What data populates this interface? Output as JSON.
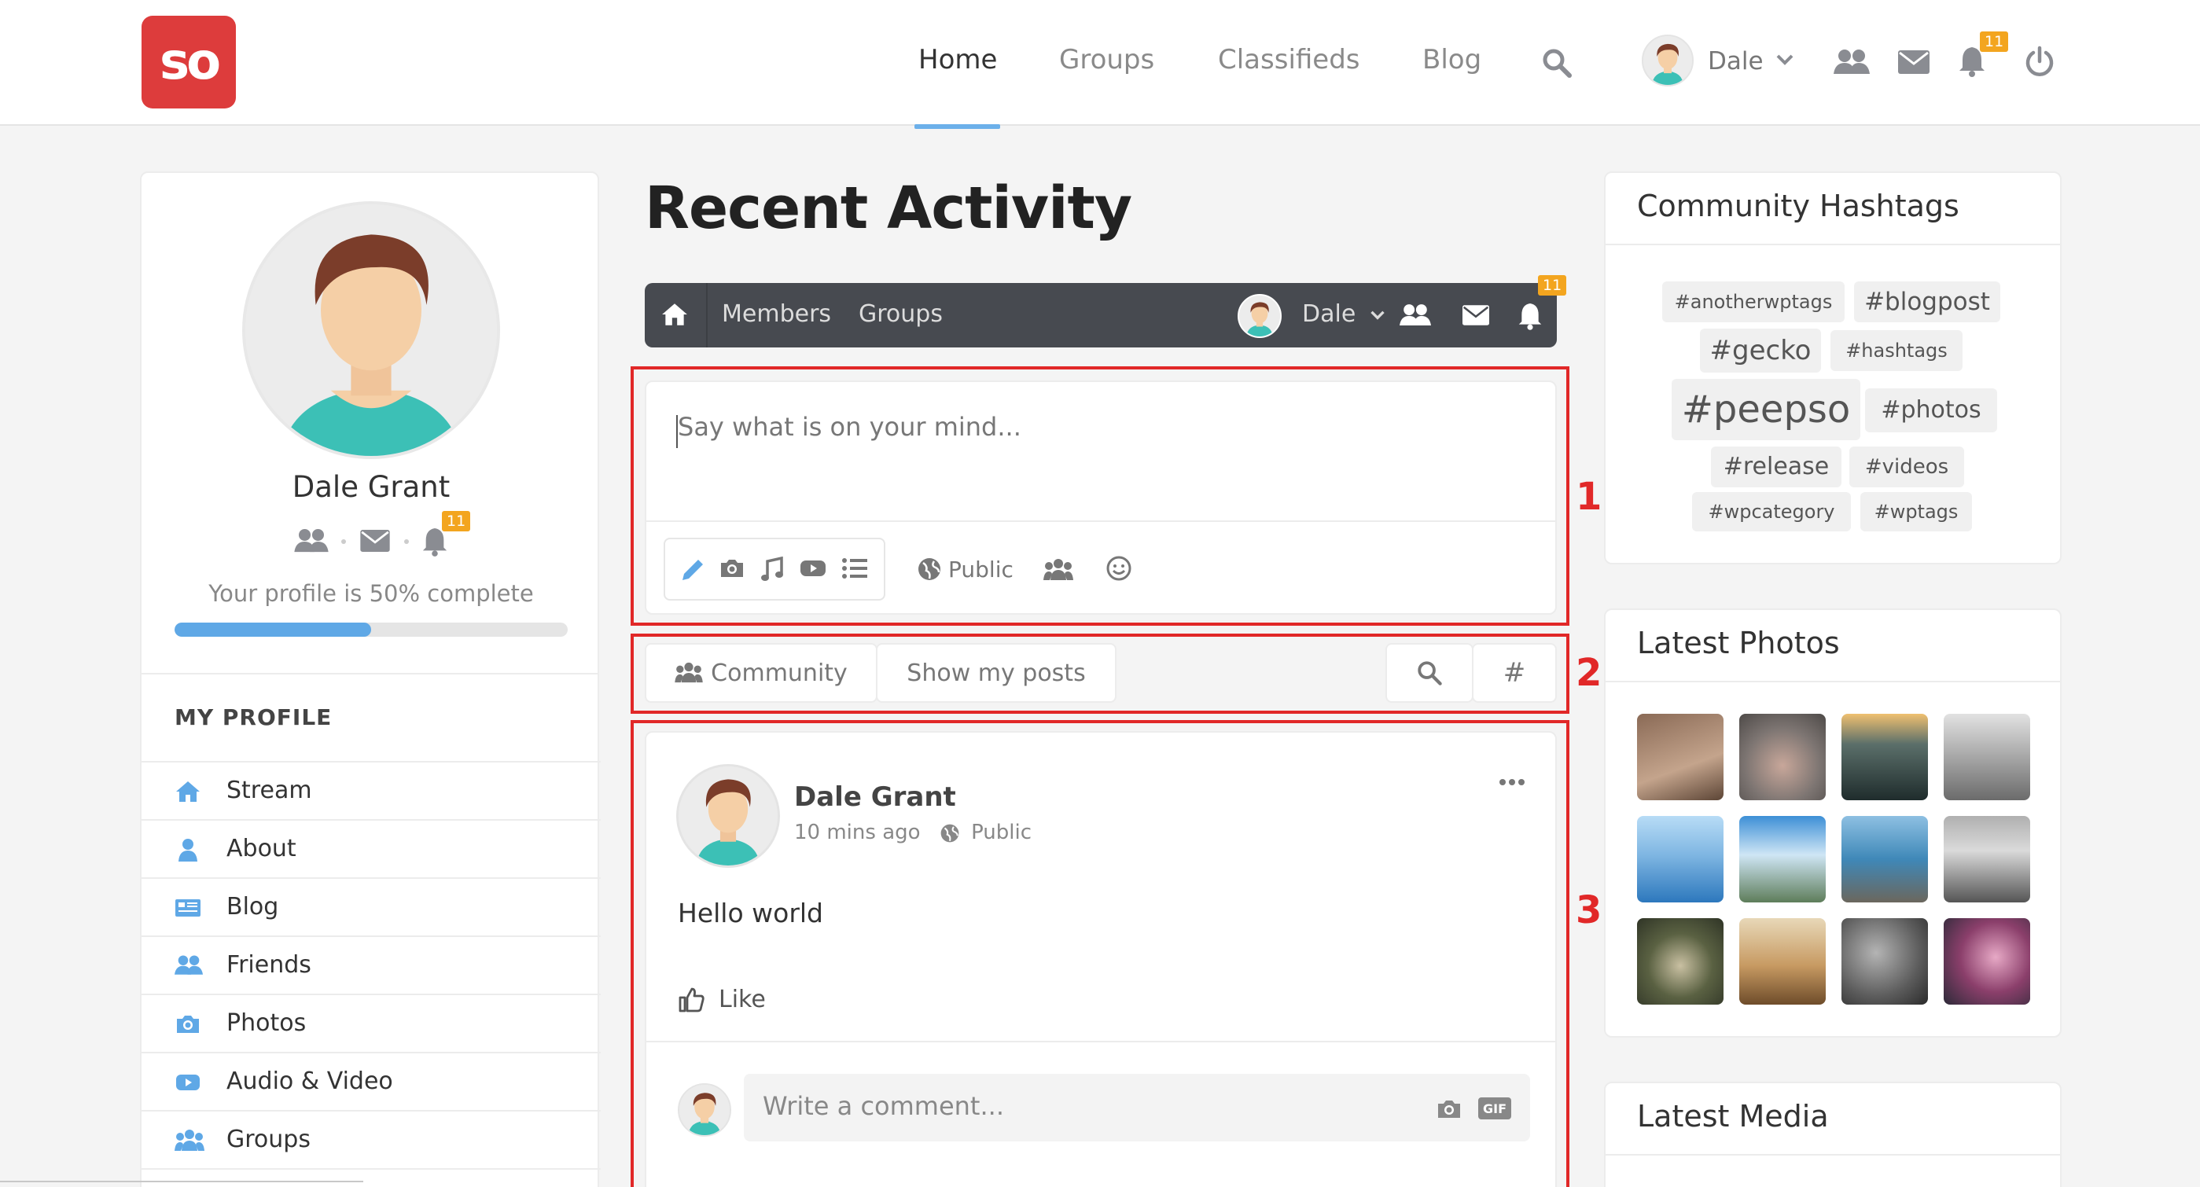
{
  "header": {
    "logo_text": "so",
    "nav": [
      "Home",
      "Groups",
      "Classifieds",
      "Blog"
    ],
    "user_name": "Dale",
    "notification_count": "11"
  },
  "profile": {
    "name": "Dale Grant",
    "notification_count": "11",
    "completion_text": "Your profile is 50% complete",
    "completion_fraction": 0.5,
    "section_heading": "MY PROFILE",
    "menu": [
      {
        "label": "Stream",
        "icon": "home-icon"
      },
      {
        "label": "About",
        "icon": "user-icon"
      },
      {
        "label": "Blog",
        "icon": "blog-icon"
      },
      {
        "label": "Friends",
        "icon": "friends-icon"
      },
      {
        "label": "Photos",
        "icon": "camera-icon"
      },
      {
        "label": "Audio & Video",
        "icon": "video-icon"
      },
      {
        "label": "Groups",
        "icon": "groups-icon"
      }
    ]
  },
  "main": {
    "title": "Recent Activity",
    "toolbar": {
      "members": "Members",
      "groups": "Groups",
      "user_name": "Dale",
      "notification_count": "11"
    },
    "composer": {
      "placeholder": "Say what is on your mind...",
      "privacy": "Public"
    },
    "filters": {
      "community": "Community",
      "show_my_posts": "Show my posts",
      "hashtag_symbol": "#"
    },
    "post": {
      "author": "Dale Grant",
      "time": "10 mins ago",
      "privacy": "Public",
      "text": "Hello world",
      "like_label": "Like",
      "comment_placeholder": "Write a comment...",
      "gif_label": "GIF"
    },
    "annotations": [
      "1",
      "2",
      "3"
    ]
  },
  "sidebar": {
    "hashtags_title": "Community Hashtags",
    "hashtags": [
      "#anotherwptags",
      "#blogpost",
      "#gecko",
      "#hashtags",
      "#peepso",
      "#photos",
      "#release",
      "#videos",
      "#wpcategory",
      "#wptags"
    ],
    "photos_title": "Latest Photos",
    "media_title": "Latest Media"
  },
  "colors": {
    "brand": "#dd3c3c",
    "accent": "#5fa8e6",
    "badge": "#f3a51f",
    "annotation": "#e12828",
    "toolbar": "#474a50"
  }
}
